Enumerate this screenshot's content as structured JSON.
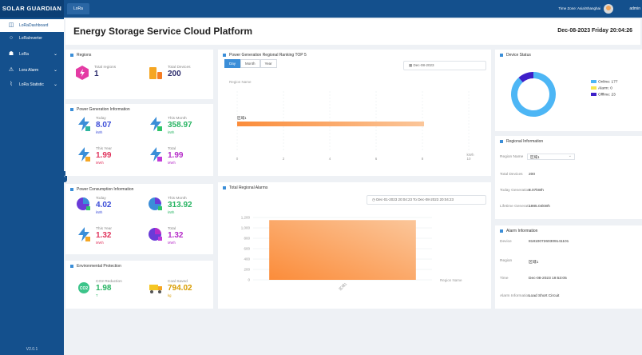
{
  "app": {
    "brand": "SOLAR GUARDIAN",
    "tab": "LoRa",
    "timezone": "Time Zone: Asia/Shanghai",
    "user": "admin",
    "version": "V2.0.1"
  },
  "sidebar": {
    "items": [
      {
        "label": "LoRaDashboard",
        "icon": "dashboard-icon"
      },
      {
        "label": "LoRaInverter",
        "icon": "inverter-icon"
      },
      {
        "label": "LoRa",
        "icon": "lora-icon"
      },
      {
        "label": "Lora Alarm",
        "icon": "alarm-icon"
      },
      {
        "label": "LoRa Statistic",
        "icon": "statistic-icon"
      }
    ]
  },
  "header": {
    "title": "Energy Storage Service Cloud Platform",
    "date": "Dec-08-2023 Friday 20:04:26"
  },
  "regions": {
    "title": "Regions",
    "total_regions_label": "Total regions",
    "total_regions": "1",
    "total_devices_label": "Total Devices",
    "total_devices": "200"
  },
  "power_generation": {
    "title": "Power Generation Information",
    "today": {
      "label": "Today",
      "value": "8.07",
      "unit": "kWh"
    },
    "month": {
      "label": "This Month",
      "value": "358.97",
      "unit": "kWh"
    },
    "year": {
      "label": "This Year",
      "value": "1.99",
      "unit": "MWh"
    },
    "total": {
      "label": "Total",
      "value": "1.99",
      "unit": "MWh"
    }
  },
  "power_consumption": {
    "title": "Power Consumption Information",
    "today": {
      "label": "Today",
      "value": "4.02",
      "unit": "kWh"
    },
    "month": {
      "label": "This Month",
      "value": "313.92",
      "unit": "kWh"
    },
    "year": {
      "label": "This Year",
      "value": "1.32",
      "unit": "MWh"
    },
    "total": {
      "label": "Total",
      "value": "1.32",
      "unit": "MWh"
    }
  },
  "environmental": {
    "title": "Environmental Protection",
    "co2": {
      "label": "CO2 Reduction",
      "value": "1.98",
      "unit": "T",
      "icon_text": "CO2"
    },
    "coal": {
      "label": "Coal Saved",
      "value": "794.02",
      "unit": "kg"
    }
  },
  "ranking": {
    "title": "Power Generation Regional Ranking TOP 5",
    "buttons": [
      "Day",
      "Month",
      "Year"
    ],
    "date": "Dec-08-2023",
    "axis_name": "Region Name",
    "unit": "kWh"
  },
  "alarms": {
    "title": "Total Regional Alarms",
    "start": "Dec-01-2023 20:04:23",
    "to": "To",
    "end": "Dec-08-2023 20:04:23",
    "axis_name": "Region Name"
  },
  "device_status": {
    "title": "Device Status",
    "legend": [
      {
        "label": "Online: 177",
        "color": "#4db6f5"
      },
      {
        "label": "Alarm: 0",
        "color": "#f5e64d"
      },
      {
        "label": "Offline: 23",
        "color": "#3d1fc8"
      }
    ]
  },
  "regional_info": {
    "title": "Regional Information",
    "region_label": "Region Name",
    "region_value": "区域1",
    "devices_label": "Total Devices",
    "devices_value": "200",
    "today_label": "Today Generation",
    "today_value": "8.07kWh",
    "lifetime_label": "Lifetime Generati...",
    "lifetime_value": "1985.04kWh"
  },
  "alarm_info": {
    "title": "Alarm Information",
    "device_label": "Device",
    "device_value": "8181007260309141101",
    "region_label": "Region",
    "region_value": "区域1",
    "time_label": "Time",
    "time_value": "Dec-08-2023 19:53:05",
    "info_label": "Alarm Information",
    "info_value": "Load Short Circuit"
  },
  "chart_data": [
    {
      "type": "bar",
      "orientation": "horizontal",
      "title": "Power Generation Regional Ranking TOP 5",
      "categories": [
        "区域1"
      ],
      "values": [
        8.07
      ],
      "xlim": [
        0,
        10
      ],
      "xticks": [
        0,
        2,
        4,
        6,
        8,
        10
      ],
      "xlabel": "kWh",
      "ylabel": "Region Name",
      "color": "#f5a05a"
    },
    {
      "type": "bar",
      "title": "Total Regional Alarms",
      "categories": [
        "区域1"
      ],
      "values": [
        1150
      ],
      "ylim": [
        0,
        1200
      ],
      "yticks": [
        0,
        200,
        400,
        600,
        800,
        1000,
        1200
      ],
      "xlabel": "Region Name",
      "color": "#f5a05a"
    },
    {
      "type": "pie",
      "title": "Device Status",
      "categories": [
        "Online",
        "Alarm",
        "Offline"
      ],
      "values": [
        177,
        0,
        23
      ],
      "colors": [
        "#4db6f5",
        "#f5e64d",
        "#3d1fc8"
      ]
    }
  ]
}
